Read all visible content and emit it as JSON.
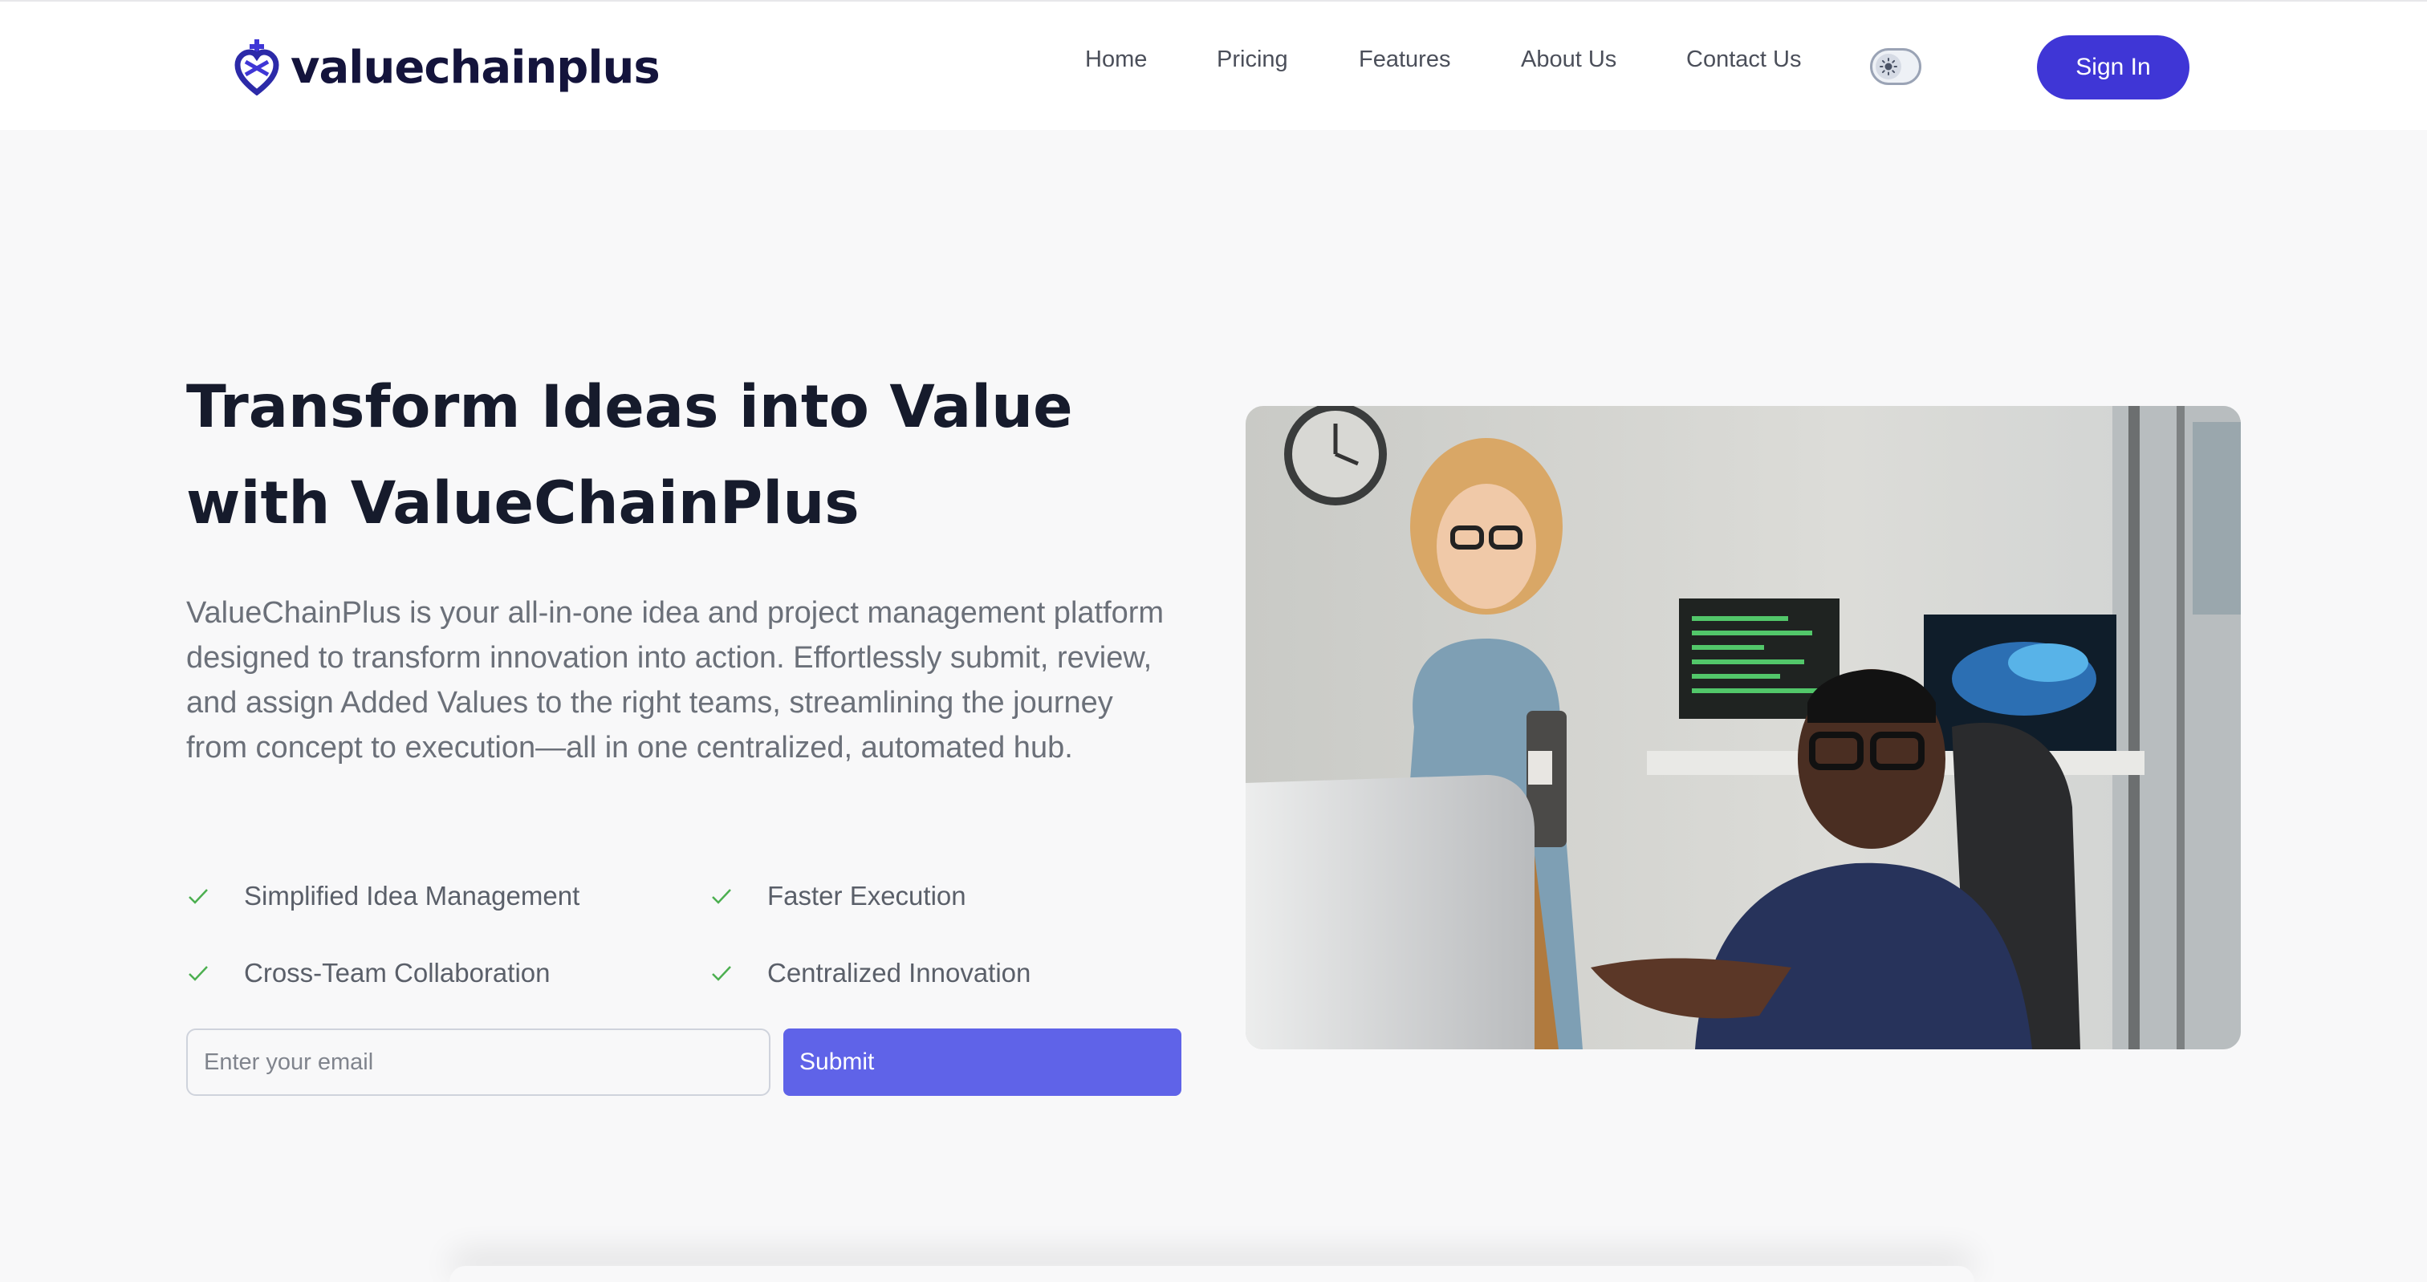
{
  "brand": {
    "name": "valuechainplus",
    "logo_icon": "heart-cross-logo-icon",
    "color": "#14143c"
  },
  "nav": {
    "items": [
      "Home",
      "Pricing",
      "Features",
      "About Us",
      "Contact Us"
    ],
    "theme_toggle_icon": "sun-icon",
    "sign_in_label": "Sign In"
  },
  "hero": {
    "title_line1": "Transform Ideas into Value",
    "title_line2": "with ValueChainPlus",
    "description": "ValueChainPlus is your all-in-one idea and project management platform designed to transform innovation into action. Effortlessly submit, review, and assign Added Values to the right teams, streamlining the journey from concept to execution—all in one centralized, automated hub.",
    "features": [
      "Simplified Idea Management",
      "Faster Execution",
      "Cross-Team Collaboration",
      "Centralized Innovation"
    ],
    "email_placeholder": "Enter your email",
    "submit_label": "Submit",
    "image_subject": "two-coworkers-office-photo"
  },
  "colors": {
    "accent": "#3f36d6",
    "submit": "#5f63e8",
    "check": "#4caf50",
    "background": "#f8f8f9"
  }
}
